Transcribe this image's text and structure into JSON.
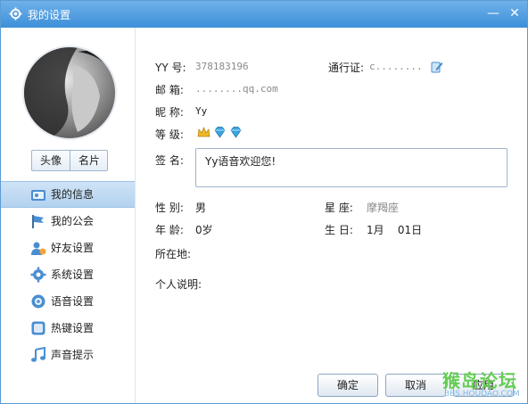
{
  "window": {
    "title": "我的设置",
    "minimize_label": "—",
    "close_label": "✕"
  },
  "sidebar": {
    "pic_tabs": [
      "头像",
      "名片"
    ],
    "items": [
      {
        "label": "我的信息",
        "icon": "id-card-icon",
        "active": true
      },
      {
        "label": "我的公会",
        "icon": "flag-icon",
        "active": false
      },
      {
        "label": "好友设置",
        "icon": "friends-icon",
        "active": false
      },
      {
        "label": "系统设置",
        "icon": "gear-icon",
        "active": false
      },
      {
        "label": "语音设置",
        "icon": "speaker-icon",
        "active": false
      },
      {
        "label": "热键设置",
        "icon": "keyboard-icon",
        "active": false
      },
      {
        "label": "声音提示",
        "icon": "music-note-icon",
        "active": false
      }
    ]
  },
  "profile": {
    "yy_label": "YY  号:",
    "yy_value": "378183196",
    "passport_label": "通行证:",
    "passport_value": "c........",
    "email_label": "邮    箱:",
    "email_value": "........qq.com",
    "nickname_label": "昵    称:",
    "nickname_value": "Yy",
    "level_label": "等    级:",
    "signature_label": "签    名:",
    "signature_value": "Yy语音欢迎您!",
    "gender_label": "性    别:",
    "gender_value": "男",
    "zodiac_label": "星    座:",
    "zodiac_value": "摩羯座",
    "age_label": "年    龄:",
    "age_value": "0岁",
    "birthday_label": "生    日:",
    "birthday_value": "1月    01日",
    "location_label": "所在地:",
    "location_value": "",
    "bio_label": "个人说明:",
    "bio_value": ""
  },
  "buttons": {
    "ok": "确定",
    "cancel": "取消",
    "apply": "应用"
  },
  "watermark": {
    "main": "猴岛论坛",
    "sub": "BBS.HOUDAO.COM"
  },
  "colors": {
    "titlebar": "#3c8fd8",
    "nav_active": "#b3d2ef",
    "badge_gem": "#3aa6e0",
    "badge_crown": "#f0b92a"
  }
}
